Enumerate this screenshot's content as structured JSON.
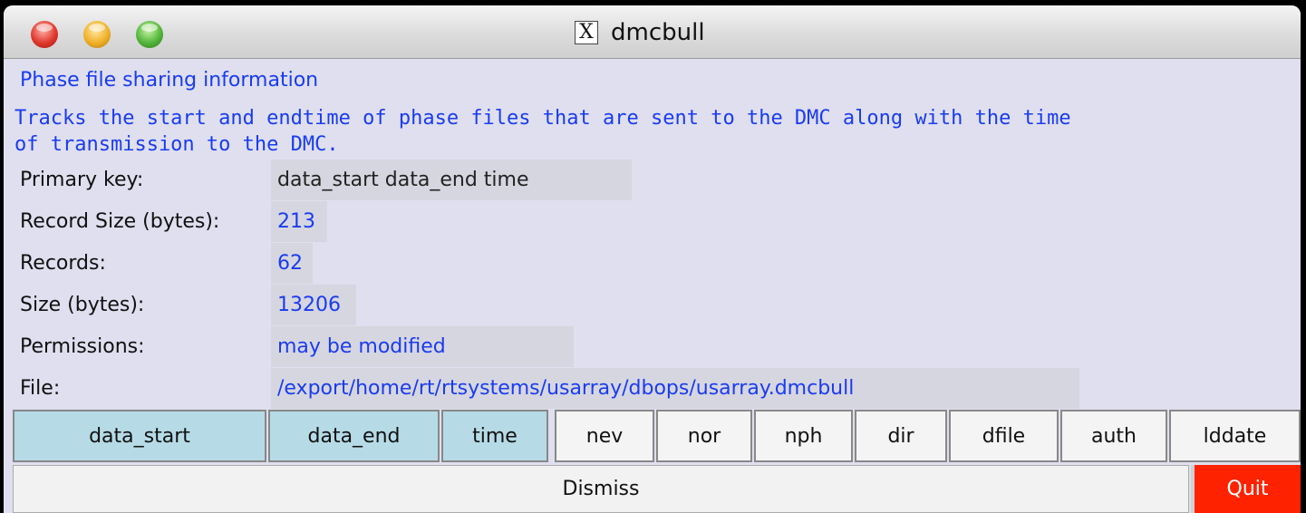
{
  "window": {
    "title": "dmcbull"
  },
  "info": {
    "heading": "Phase file sharing information",
    "description_line1": "Tracks the start and endtime of phase files that are sent to the DMC along with the time",
    "description_line2": "of transmission to the DMC."
  },
  "properties": {
    "primary_key_label": "Primary key:",
    "primary_key_value": "data_start data_end time",
    "record_size_label": "Record Size (bytes):",
    "record_size_value": "213",
    "records_label": "Records:",
    "records_value": "62",
    "size_label": "Size (bytes):",
    "size_value": "13206",
    "permissions_label": "Permissions:",
    "permissions_value": "may be modified",
    "file_label": "File:",
    "file_value": "/export/home/rt/rtsystems/usarray/dbops/usarray.dmcbull"
  },
  "fields": [
    "data_start",
    "data_end",
    "time",
    "nev",
    "nor",
    "nph",
    "dir",
    "dfile",
    "auth",
    "lddate"
  ],
  "buttons": {
    "dismiss": "Dismiss",
    "quit": "Quit"
  },
  "colors": {
    "accent_text": "#1a3cf0",
    "key_field": "#b6dbe7",
    "quit": "#ff2200"
  }
}
